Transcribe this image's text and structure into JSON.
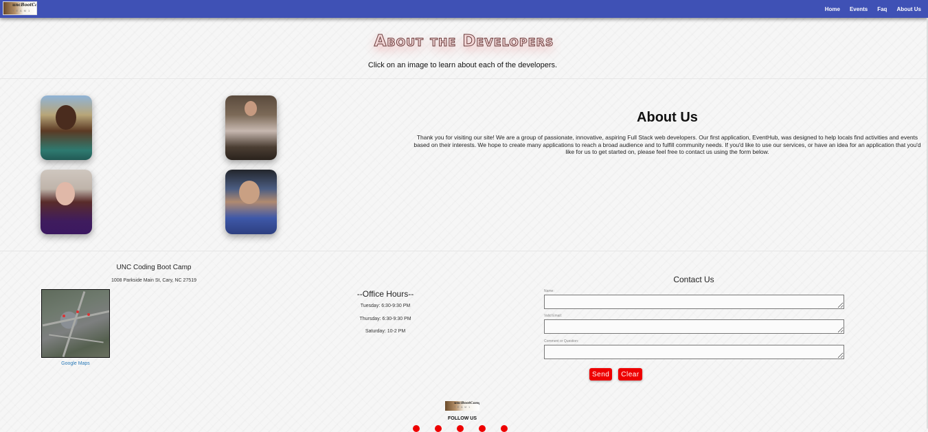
{
  "navbar": {
    "logo_text": "uncBootCamp",
    "logo_subtext": "T E A M 1",
    "links": [
      "Home",
      "Events",
      "Faq",
      "About Us"
    ]
  },
  "hero": {
    "title": "About the Developers",
    "subtitle": "Click on an image to learn about each of the developers."
  },
  "about": {
    "title": "About Us",
    "text": "Thank you for visiting our site! We are a group of passionate, innovative, aspiring Full Stack web developers. Our first application, EventHub, was designed to help locals find activities and events based on their interests. We hope to create many applications to reach a broad audience and to fulfill community needs. If you'd like to use our services, or have an idea for an application that you'd like for us to get started on, please feel free to contact us using the form below."
  },
  "location": {
    "name": "UNC Coding Boot Camp",
    "address": "1008 Parkside Main St, Cary, NC 27519",
    "map_link": "Google Maps"
  },
  "office_hours": {
    "title": "--Office Hours--",
    "lines": [
      "Tuesday: 6:30-9:30 PM",
      "Thursday: 6:30-9:30 PM",
      "Saturday: 10-2 PM"
    ]
  },
  "contact": {
    "title": "Contact Us",
    "fields": [
      "Name:",
      "Valid Email:",
      "Comment or Question:"
    ],
    "send_label": "Send",
    "clear_label": "Clear"
  },
  "footer": {
    "logo_text": "uncBootCamp",
    "logo_subtext": "T E A M 1",
    "follow_label": "FOLLOW US"
  },
  "colors": {
    "navbar": "#3f51b5",
    "button": "#ee0000",
    "link": "#2a7ab8"
  }
}
